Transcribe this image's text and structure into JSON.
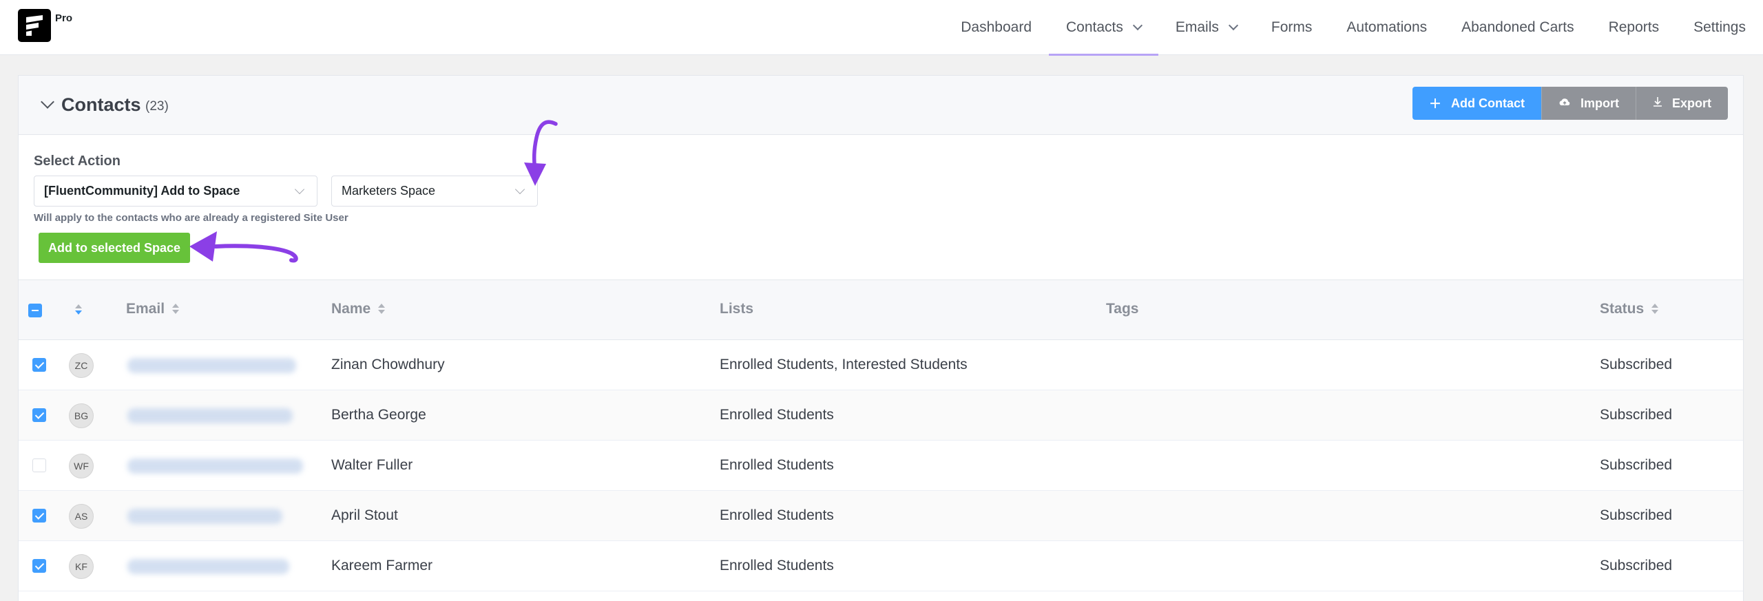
{
  "app": {
    "badge": "Pro"
  },
  "nav": {
    "items": [
      {
        "label": "Dashboard",
        "active": false,
        "dropdown": false
      },
      {
        "label": "Contacts",
        "active": true,
        "dropdown": true
      },
      {
        "label": "Emails",
        "active": false,
        "dropdown": true
      },
      {
        "label": "Forms",
        "active": false,
        "dropdown": false
      },
      {
        "label": "Automations",
        "active": false,
        "dropdown": false
      },
      {
        "label": "Abandoned Carts",
        "active": false,
        "dropdown": false
      },
      {
        "label": "Reports",
        "active": false,
        "dropdown": false
      },
      {
        "label": "Settings",
        "active": false,
        "dropdown": false
      }
    ]
  },
  "header": {
    "title": "Contacts",
    "count": "(23)",
    "add_label": "Add Contact",
    "import_label": "Import",
    "export_label": "Export"
  },
  "bulk": {
    "label": "Select Action",
    "action_value": "[FluentCommunity] Add to Space",
    "space_value": "Marketers Space",
    "hint": "Will apply to the contacts who are already a registered Site User",
    "submit_label": "Add to selected Space"
  },
  "table": {
    "columns": {
      "email": "Email",
      "name": "Name",
      "lists": "Lists",
      "tags": "Tags",
      "status": "Status"
    },
    "rows": [
      {
        "initials": "ZC",
        "name": "Zinan Chowdhury",
        "lists": "Enrolled Students, Interested Students",
        "tags": "",
        "status": "Subscribed",
        "checked": true
      },
      {
        "initials": "BG",
        "name": "Bertha George",
        "lists": "Enrolled Students",
        "tags": "",
        "status": "Subscribed",
        "checked": true
      },
      {
        "initials": "WF",
        "name": "Walter Fuller",
        "lists": "Enrolled Students",
        "tags": "",
        "status": "Subscribed",
        "checked": false
      },
      {
        "initials": "AS",
        "name": "April Stout",
        "lists": "Enrolled Students",
        "tags": "",
        "status": "Subscribed",
        "checked": true
      },
      {
        "initials": "KF",
        "name": "Kareem Farmer",
        "lists": "Enrolled Students",
        "tags": "",
        "status": "Subscribed",
        "checked": true
      }
    ]
  },
  "colors": {
    "accent": "#409eff",
    "green": "#67c23a",
    "annotation": "#8b3fe6",
    "nav_active": "#b7a4f6"
  }
}
